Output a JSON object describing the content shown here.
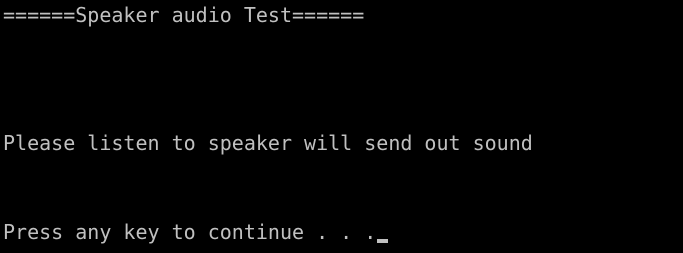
{
  "console": {
    "header_line": "======Speaker audio Test======",
    "instruction_line": "Please listen to speaker will send out sound",
    "prompt_line": "Press any key to continue . . .",
    "text_color": "#c0c0c0",
    "background_color": "#000000"
  }
}
